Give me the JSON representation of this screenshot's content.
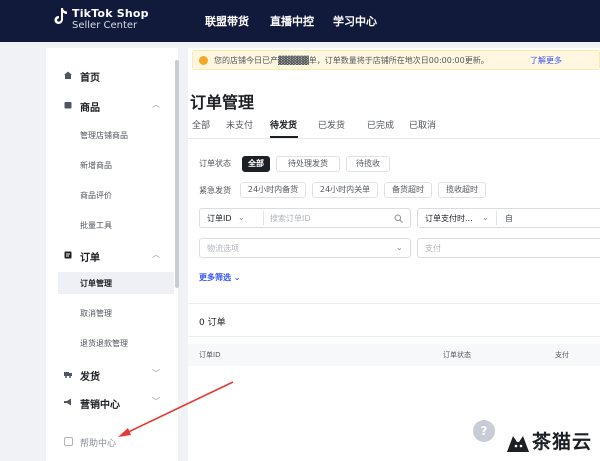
{
  "header": {
    "brand_line1": "TikTok Shop",
    "brand_line2": "Seller Center",
    "nav": [
      "联盟带货",
      "直播中控",
      "学习中心"
    ]
  },
  "sidebar": {
    "home": "首页",
    "products": {
      "label": "商品",
      "items": [
        "管理店铺商品",
        "新增商品",
        "商品评价",
        "批量工具"
      ]
    },
    "orders": {
      "label": "订单",
      "items": [
        "订单管理",
        "取消管理",
        "退货退款管理"
      ]
    },
    "shipping": "发货",
    "marketing": "营销中心",
    "help": "帮助中心"
  },
  "notice": {
    "text": "您的店铺今日已产▓▓▓▓▓单，订单数量将于店铺所在地次日00:00:00更新。",
    "link": "了解更多",
    "color": "#f5a623"
  },
  "page": {
    "title": "订单管理",
    "tabs": [
      "全部",
      "未支付",
      "待发货",
      "已发货",
      "已完成",
      "已取消"
    ],
    "active_tab": "待发货"
  },
  "filters": {
    "status_label": "订单状态",
    "status_chips": [
      "全部",
      "待处理发货",
      "待揽收"
    ],
    "urgent_label": "紧急发货",
    "urgent_chips": [
      "24小时内备货",
      "24小时内关单",
      "备货超时",
      "揽收超时"
    ],
    "order_id_label": "订单ID",
    "order_id_placeholder": "搜索订单ID",
    "pay_time_label": "订单支付时...",
    "pay_time_to": "自",
    "logistics_placeholder": "物流选项",
    "payment_placeholder": "支付",
    "more_filters": "更多筛选"
  },
  "results": {
    "count_text": "0 订单",
    "columns": [
      "订单ID",
      "订单状态",
      "支付"
    ]
  },
  "float_help": "?",
  "watermark": "茶猫云",
  "colors": {
    "topbar": "#111a3b",
    "accent": "#3955f6",
    "arrow": "#e53935"
  }
}
